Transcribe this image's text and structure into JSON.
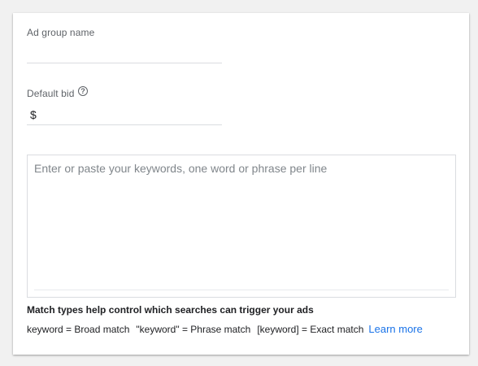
{
  "ad_group": {
    "name_label": "Ad group name",
    "name_value": "",
    "bid_label": "Default bid",
    "help_icon": "help-circle-icon",
    "currency_symbol": "$",
    "bid_value": ""
  },
  "keywords": {
    "placeholder": "Enter or paste your keywords, one word or phrase per line",
    "value": ""
  },
  "match_types": {
    "title": "Match types help control which searches can trigger your ads",
    "broad": "keyword = Broad match",
    "phrase": "\"keyword\" = Phrase match",
    "exact": "[keyword] = Exact match",
    "learn_more": "Learn more"
  },
  "colors": {
    "link": "#1a73e8",
    "label": "#5f6368",
    "border": "#dadce0"
  }
}
